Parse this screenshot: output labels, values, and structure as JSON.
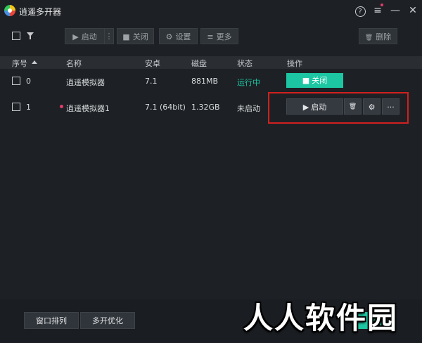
{
  "app": {
    "title": "逍遥多开器"
  },
  "window_controls": {
    "help": "?",
    "menu": "≡",
    "minimize": "—",
    "close": "✕"
  },
  "toolbar": {
    "start_label": "启动",
    "stop_label": "关闭",
    "settings_label": "设置",
    "more_label": "更多",
    "delete_label": "删除",
    "more_dots": "⋮"
  },
  "table": {
    "headers": {
      "index": "序号",
      "name": "名称",
      "android": "安卓",
      "disk": "磁盘",
      "status": "状态",
      "ops": "操作"
    },
    "rows": [
      {
        "index": "0",
        "name": "逍遥模拟器",
        "android": "7.1",
        "disk": "881MB",
        "status": "运行中",
        "action": "关闭"
      },
      {
        "index": "1",
        "name": "逍遥模拟器1",
        "android": "7.1 (64bit)",
        "disk": "1.32GB",
        "status": "未启动",
        "action": "启动",
        "more": "···"
      }
    ]
  },
  "footer": {
    "arrange_label": "窗口排列",
    "optimize_label": "多开优化"
  },
  "watermark": {
    "text": "人人软件园"
  },
  "colors": {
    "accent": "#1dc6a3",
    "highlight": "#d2201f",
    "bg": "#1d2125",
    "dot": "#e23c6b"
  },
  "icons": {
    "play": "▶",
    "stop": "■",
    "gear": "⚙",
    "menu": "≡",
    "trash": "🗑"
  }
}
